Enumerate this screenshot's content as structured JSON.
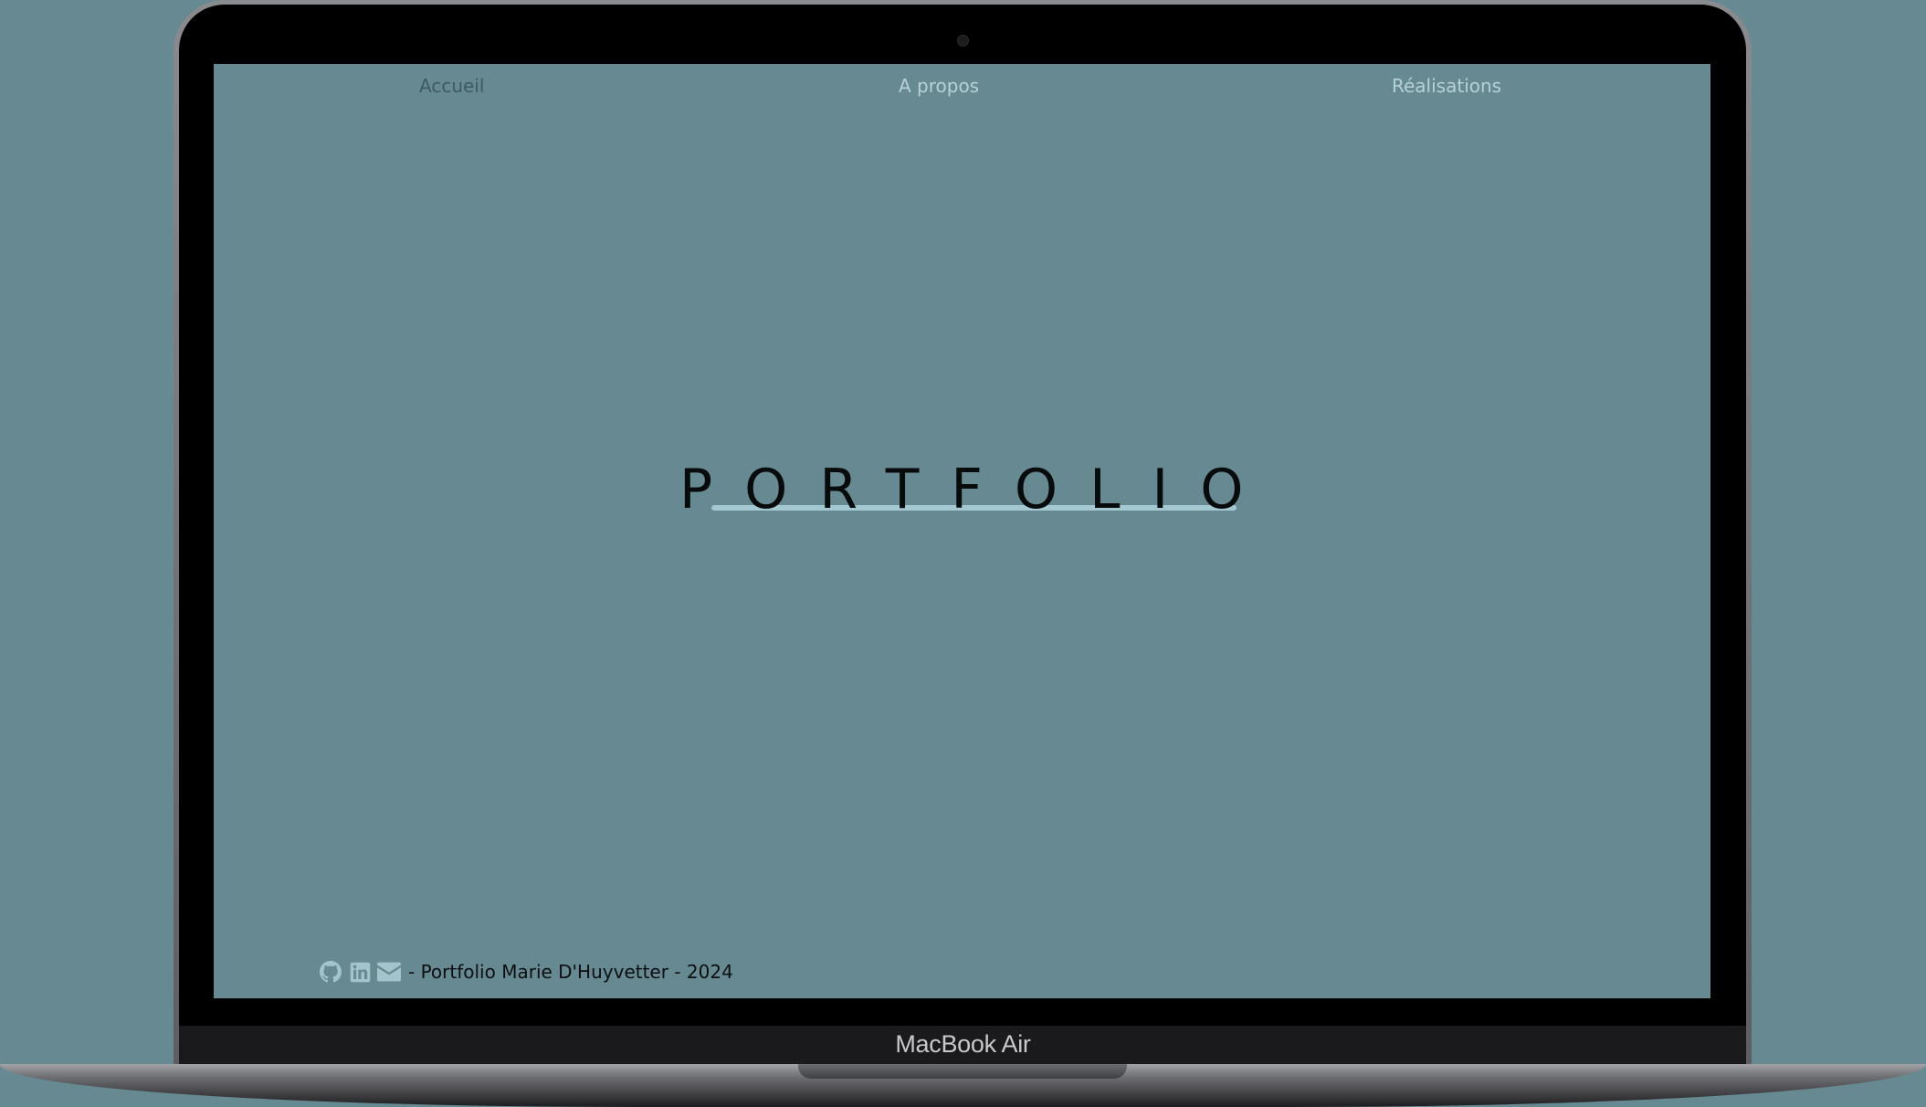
{
  "device": {
    "label": "MacBook Air"
  },
  "nav": {
    "items": [
      {
        "label": "Accueil",
        "active": true
      },
      {
        "label": "A propos",
        "active": false
      },
      {
        "label": "Réalisations",
        "active": false
      }
    ]
  },
  "hero": {
    "title": "PORTFOLIO"
  },
  "footer": {
    "icons": [
      "github-icon",
      "linkedin-icon",
      "mail-icon"
    ],
    "text": "- Portfolio Marie D'Huyvetter - 2024"
  },
  "colors": {
    "page_background": "#668992",
    "nav_active": "#3f5a62",
    "nav_inactive": "#b7d1d7",
    "hero_line": "#a4c8d1",
    "text_dark": "#0b0f10"
  }
}
